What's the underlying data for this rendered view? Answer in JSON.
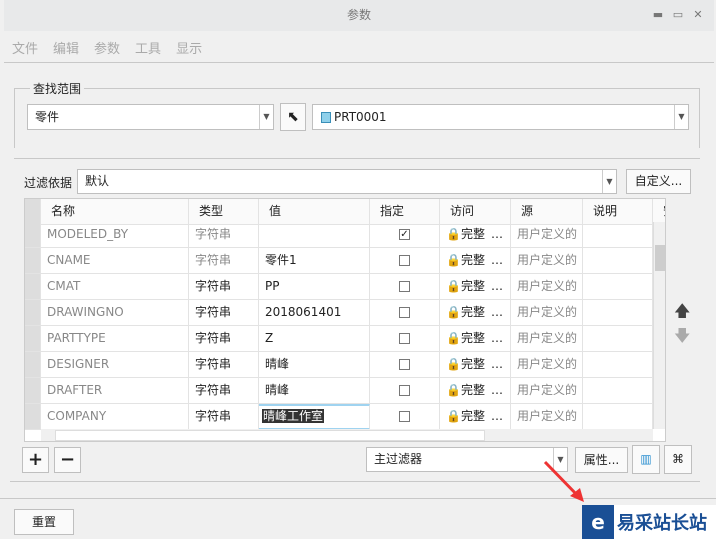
{
  "window": {
    "title": "参数"
  },
  "menu": [
    "文件",
    "编辑",
    "参数",
    "工具",
    "显示"
  ],
  "scope": {
    "legend": "查找范围",
    "type_value": "零件",
    "model_value": "PRT0001"
  },
  "filter": {
    "label": "过滤依据",
    "value": "默认",
    "custom_button": "自定义..."
  },
  "table": {
    "columns": [
      "名称",
      "类型",
      "值",
      "指定",
      "访问",
      "源",
      "说明",
      "安"
    ],
    "rows": [
      {
        "name": "MODELED_BY",
        "type": "字符串",
        "value": "",
        "designated": true,
        "access": "完整",
        "source": "用户定义的",
        "type_gray": true
      },
      {
        "name": "CNAME",
        "type": "字符串",
        "value": "零件1",
        "designated": false,
        "access": "完整",
        "source": "用户定义的",
        "type_gray": true
      },
      {
        "name": "CMAT",
        "type": "字符串",
        "value": "PP",
        "designated": false,
        "access": "完整",
        "source": "用户定义的"
      },
      {
        "name": "DRAWINGNO",
        "type": "字符串",
        "value": "2018061401",
        "designated": false,
        "access": "完整",
        "source": "用户定义的"
      },
      {
        "name": "PARTTYPE",
        "type": "字符串",
        "value": "Z",
        "designated": false,
        "access": "完整",
        "source": "用户定义的"
      },
      {
        "name": "DESIGNER",
        "type": "字符串",
        "value": "晴峰",
        "designated": false,
        "access": "完整",
        "source": "用户定义的"
      },
      {
        "name": "DRAFTER",
        "type": "字符串",
        "value": "晴峰",
        "designated": false,
        "access": "完整",
        "source": "用户定义的"
      },
      {
        "name": "COMPANY",
        "type": "字符串",
        "value": "晴峰工作室",
        "designated": false,
        "access": "完整",
        "source": "用户定义的",
        "editing": true
      }
    ]
  },
  "bottom": {
    "main_filter": "主过滤器",
    "properties_button": "属性...",
    "reset_button": "重置"
  },
  "watermark": {
    "text": "易采站长站"
  }
}
